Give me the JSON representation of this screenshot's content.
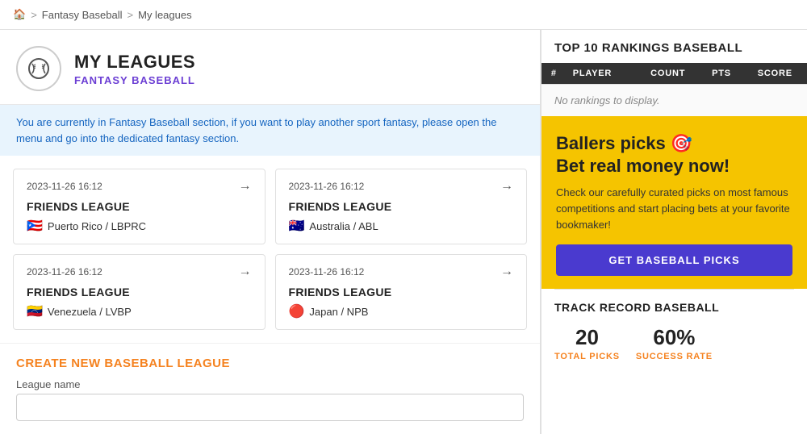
{
  "breadcrumb": {
    "home_icon": "🏠",
    "items": [
      "Fantasy Baseball",
      "My leagues"
    ]
  },
  "header": {
    "icon_symbol": "⚾",
    "title": "MY LEAGUES",
    "subtitle": "FANTASY BASEBALL"
  },
  "info_banner": "You are currently in Fantasy Baseball section, if you want to play another sport fantasy, please open the menu and go into the dedicated fantasy section.",
  "leagues": [
    {
      "date": "2023-11-26 16:12",
      "name": "FRIENDS LEAGUE",
      "flag": "🇵🇷",
      "region": "Puerto Rico / LBPRC"
    },
    {
      "date": "2023-11-26 16:12",
      "name": "FRIENDS LEAGUE",
      "flag": "🇦🇺",
      "region": "Australia / ABL"
    },
    {
      "date": "2023-11-26 16:12",
      "name": "FRIENDS LEAGUE",
      "flag": "🇻🇪",
      "region": "Venezuela / LVBP"
    },
    {
      "date": "2023-11-26 16:12",
      "name": "FRIENDS LEAGUE",
      "flag": "🔴",
      "region": "Japan / NPB"
    }
  ],
  "create_section": {
    "title": "CREATE NEW BASEBALL LEAGUE",
    "form_label": "League name",
    "form_placeholder": ""
  },
  "rankings": {
    "title": "TOP 10 RANKINGS BASEBALL",
    "table_headers": [
      "#",
      "PLAYER",
      "COUNT",
      "PTS",
      "SCORE"
    ],
    "empty_message": "No rankings to display."
  },
  "ad": {
    "title": "Ballers picks 🎯\nBet real money now!",
    "description": "Check our carefully curated picks on most famous competitions and start placing bets at your favorite bookmaker!",
    "button_label": "GET BASEBALL PICKS"
  },
  "track_record": {
    "title": "TRACK RECORD BASEBALL",
    "total_picks_value": "20",
    "total_picks_label": "TOTAL PICKS",
    "success_rate_value": "60%",
    "success_rate_label": "SUCCESS RATE"
  }
}
